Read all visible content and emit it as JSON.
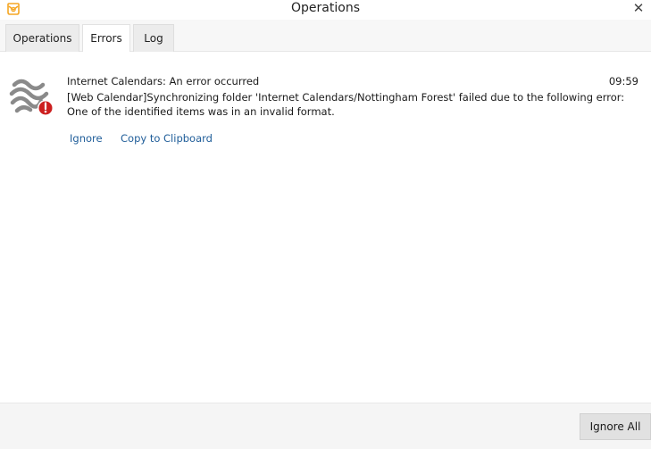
{
  "window": {
    "title": "Operations",
    "close_glyph": "✕"
  },
  "tabs": [
    {
      "label": "Operations",
      "active": false
    },
    {
      "label": "Errors",
      "active": true
    },
    {
      "label": "Log",
      "active": false
    }
  ],
  "error_entry": {
    "title": "Internet Calendars: An error occurred",
    "time": "09:59",
    "message": "[Web Calendar]Synchronizing folder 'Internet Calendars/Nottingham Forest' failed due to the following error: One of the identified items was in an invalid format.",
    "icon": "internet-calendar-error-icon",
    "actions": {
      "ignore": "Ignore",
      "copy": "Copy to Clipboard"
    }
  },
  "footer": {
    "ignore_all_label": "Ignore All"
  },
  "colors": {
    "link": "#1f5d99",
    "app_icon": "#f5a623",
    "error_badge": "#cc1f1f",
    "icon_gray": "#8a8a8a"
  }
}
